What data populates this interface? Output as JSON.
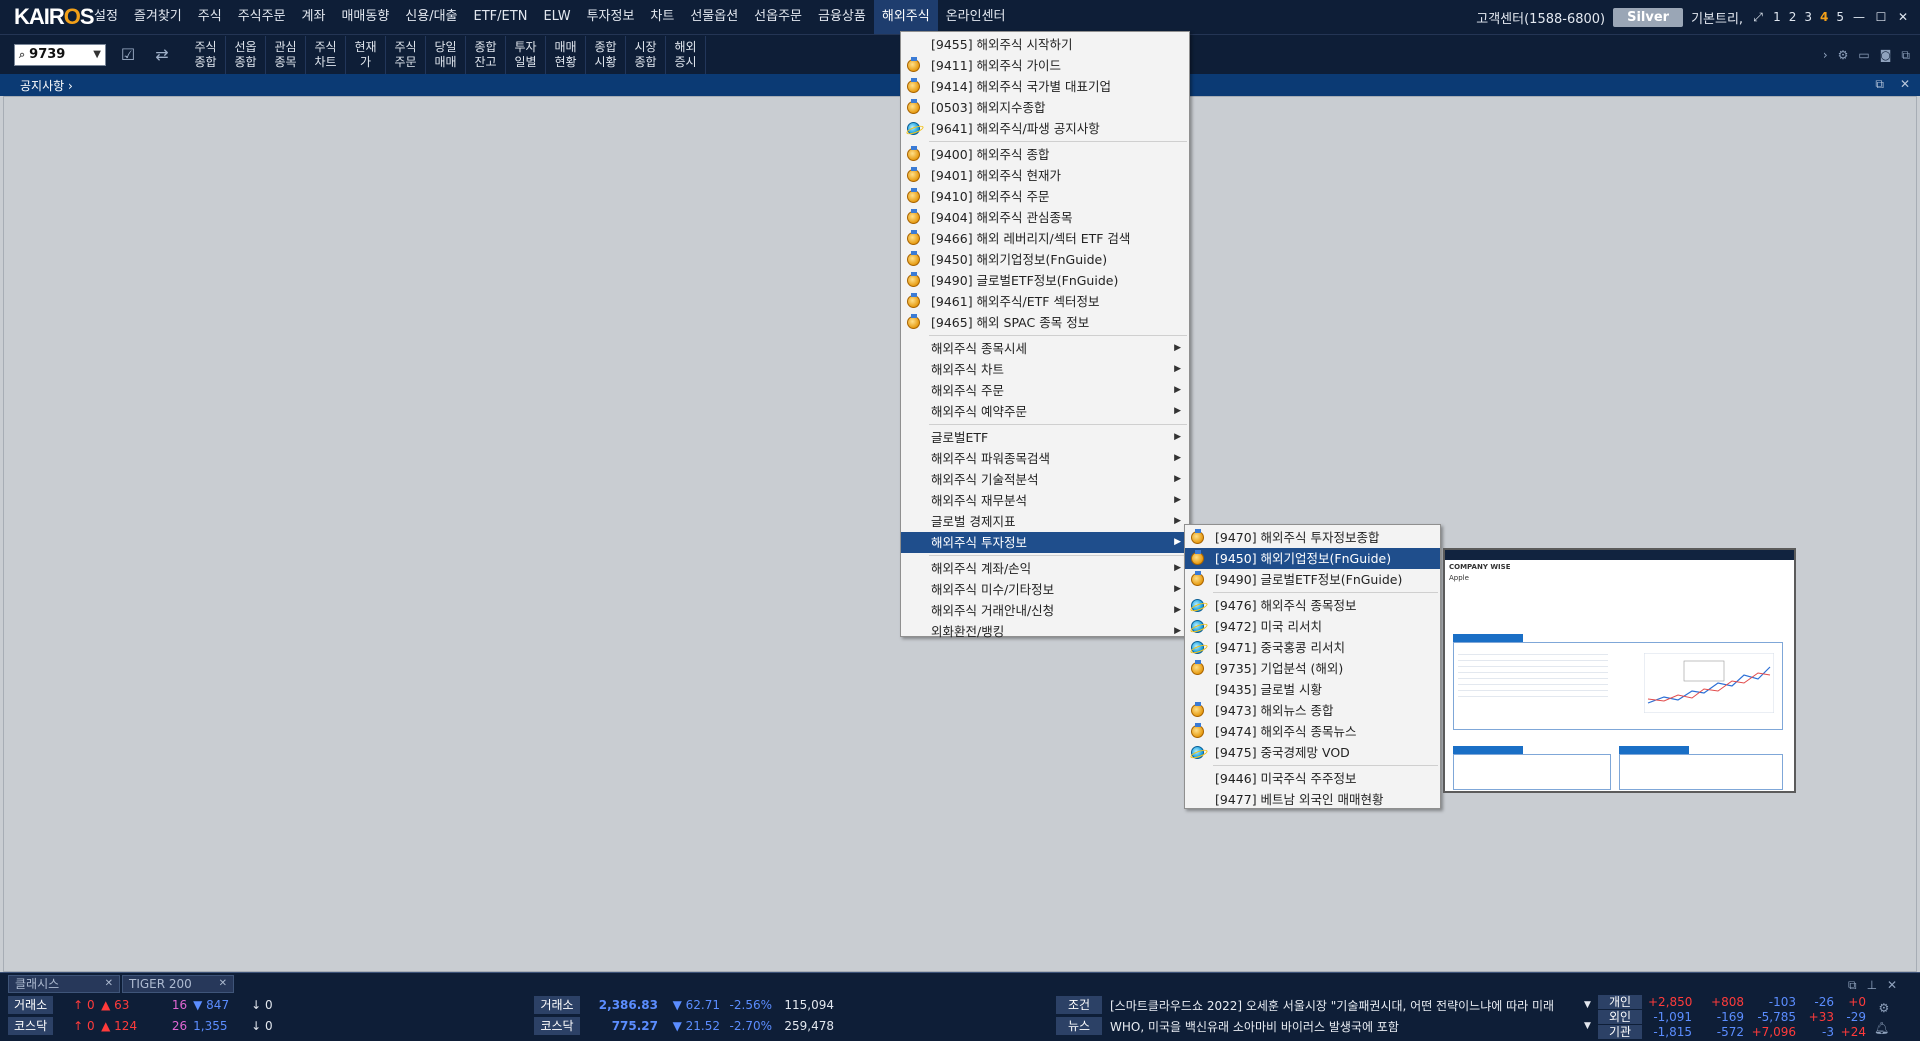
{
  "app": {
    "logo_pre": "KAIR",
    "logo_o": "O",
    "logo_post": "S"
  },
  "menubar": {
    "items": [
      "설정",
      "즐겨찾기",
      "주식",
      "주식주문",
      "계좌",
      "매매동향",
      "신용/대출",
      "ETF/ETN",
      "ELW",
      "투자정보",
      "차트",
      "선물옵션",
      "선옵주문",
      "금융상품",
      "해외주식",
      "온라인센터"
    ],
    "active_index": 14,
    "customer_center": "고객센터(1588-6800)",
    "grade_badge": "Silver",
    "layout_label": "기본트리,",
    "screen_numbers": [
      "1",
      "2",
      "3",
      "4",
      "5"
    ],
    "highlighted_screen": "4"
  },
  "toolbar": {
    "code_value": "9739",
    "buttons": [
      [
        "주식",
        "종합"
      ],
      [
        "선옵",
        "종합"
      ],
      [
        "관심",
        "종목"
      ],
      [
        "주식",
        "차트"
      ],
      [
        "현재",
        "가"
      ],
      [
        "주식",
        "주문"
      ],
      [
        "당일",
        "매매"
      ],
      [
        "종합",
        "잔고"
      ],
      [
        "투자",
        "일별"
      ],
      [
        "매매",
        "현황"
      ],
      [
        "종합",
        "시황"
      ],
      [
        "시장",
        "종합"
      ],
      [
        "해외",
        "증시"
      ]
    ]
  },
  "notice": {
    "label": "공지사항 ›"
  },
  "overseas_menu": {
    "groups": [
      [
        {
          "label": "[9455] 해외주식 시작하기",
          "icon": "none"
        },
        {
          "label": "[9411] 해외주식 가이드",
          "icon": "medal"
        },
        {
          "label": "[9414] 해외주식 국가별 대표기업",
          "icon": "medal"
        },
        {
          "label": "[0503] 해외지수종합",
          "icon": "medal"
        },
        {
          "label": "[9641] 해외주식/파생 공지사항",
          "icon": "globe"
        }
      ],
      [
        {
          "label": "[9400] 해외주식 종합",
          "icon": "medal"
        },
        {
          "label": "[9401] 해외주식 현재가",
          "icon": "medal"
        },
        {
          "label": "[9410] 해외주식 주문",
          "icon": "medal"
        },
        {
          "label": "[9404] 해외주식 관심종목",
          "icon": "medal"
        },
        {
          "label": "[9466] 해외 레버리지/섹터 ETF 검색",
          "icon": "medal"
        },
        {
          "label": "[9450] 해외기업정보(FnGuide)",
          "icon": "medal"
        },
        {
          "label": "[9490] 글로벌ETF정보(FnGuide)",
          "icon": "medal"
        },
        {
          "label": "[9461] 해외주식/ETF 섹터정보",
          "icon": "medal"
        },
        {
          "label": "[9465] 해외 SPAC 종목 정보",
          "icon": "medal"
        }
      ],
      [
        {
          "label": "해외주식 종목시세",
          "sub": true
        },
        {
          "label": "해외주식 차트",
          "sub": true
        },
        {
          "label": "해외주식 주문",
          "sub": true
        },
        {
          "label": "해외주식 예약주문",
          "sub": true
        }
      ],
      [
        {
          "label": "글로벌ETF",
          "sub": true
        },
        {
          "label": "해외주식 파워종목검색",
          "sub": true
        },
        {
          "label": "해외주식 기술적분석",
          "sub": true
        },
        {
          "label": "해외주식 재무분석",
          "sub": true
        },
        {
          "label": "글로벌 경제지표",
          "sub": true
        },
        {
          "label": "해외주식 투자정보",
          "sub": true,
          "selected": true
        }
      ],
      [
        {
          "label": "해외주식 계좌/손익",
          "sub": true
        },
        {
          "label": "해외주식 미수/기타정보",
          "sub": true
        },
        {
          "label": "해외주식 거래안내/신청",
          "sub": true
        },
        {
          "label": "외화환전/뱅킹",
          "sub": true
        }
      ]
    ]
  },
  "invest_submenu": {
    "groups": [
      [
        {
          "label": "[9470] 해외주식 투자정보종합",
          "icon": "medal"
        },
        {
          "label": "[9450] 해외기업정보(FnGuide)",
          "icon": "medal",
          "selected": true
        },
        {
          "label": "[9490] 글로벌ETF정보(FnGuide)",
          "icon": "medal"
        }
      ],
      [
        {
          "label": "[9476] 해외주식 종목정보",
          "icon": "globe"
        },
        {
          "label": "[9472] 미국 리서치",
          "icon": "globe"
        },
        {
          "label": "[9471] 중국홍콩 리서치",
          "icon": "globe"
        },
        {
          "label": "[9735] 기업분석 (해외)",
          "icon": "medal"
        },
        {
          "label": "[9435] 글로벌 시황",
          "icon": "none"
        },
        {
          "label": "[9473] 해외뉴스 종합",
          "icon": "medal"
        },
        {
          "label": "[9474] 해외주식 종목뉴스",
          "icon": "medal"
        },
        {
          "label": "[9475] 중국경제망 VOD",
          "icon": "globe"
        }
      ],
      [
        {
          "label": "[9446] 미국주식 주주정보",
          "icon": "none"
        },
        {
          "label": "[9477] 베트남 외국인 매매현황",
          "icon": "none"
        }
      ]
    ]
  },
  "preview": {
    "brand": "COMPANY WISE",
    "company": "Apple"
  },
  "bottom": {
    "tabs": [
      "클래시스",
      "TIGER 200"
    ],
    "rows": [
      {
        "label": "거래소",
        "up_count": "↑ 0",
        "rise": "▲ 63",
        "flat": "16",
        "fall": "▼ 847",
        "down_count": "↓ 0",
        "index_label": "거래소",
        "index": "2,386.83",
        "change": "▼ 62.71",
        "pct": "-2.56%",
        "volume": "115,094"
      },
      {
        "label": "코스닥",
        "up_count": "↑ 0",
        "rise": "▲ 124",
        "flat": "26",
        "fall": "1,355",
        "down_count": "↓ 0",
        "index_label": "코스닥",
        "index": "775.27",
        "change": "▼ 21.52",
        "pct": "-2.70%",
        "volume": "259,478"
      }
    ],
    "news": [
      {
        "label": "조건",
        "text": "[스마트클라우드쇼 2022] 오세훈 서울시장 \"기술패권시대, 어떤 전략이느냐에 따라 미래"
      },
      {
        "label": "뉴스",
        "text": "WHO, 미국을 백신유래 소아마비 바이러스 발생국에 포함"
      }
    ],
    "investors": [
      {
        "label": "개인",
        "values": [
          "+2,850",
          "+808",
          "-103",
          "-26",
          "+0"
        ]
      },
      {
        "label": "외인",
        "values": [
          "-1,091",
          "-169",
          "-5,785",
          "+33",
          "-29"
        ]
      },
      {
        "label": "기관",
        "values": [
          "-1,815",
          "-572",
          "+7,096",
          "-3",
          "+24"
        ]
      }
    ]
  },
  "colors": {
    "navy": "#0e1e37",
    "accent": "#f2a019",
    "selection": "#1f4e8c",
    "rise": "#ff3b3b",
    "fall": "#5b8dff"
  }
}
